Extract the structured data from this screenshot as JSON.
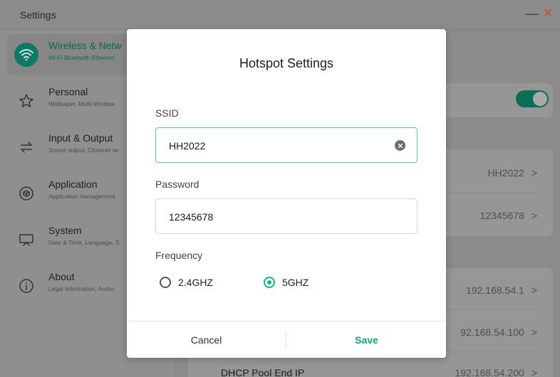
{
  "window": {
    "title": "Settings"
  },
  "sidebar": {
    "items": [
      {
        "title": "Wireless & Netw",
        "subtitle": "Wi-Fi Bluetooth Ethernet",
        "icon": "wifi-icon"
      },
      {
        "title": "Personal",
        "subtitle": "Wallpaper, Multi-Window",
        "icon": "star-icon"
      },
      {
        "title": "Input & Output",
        "subtitle": "Sound output, Channel se",
        "icon": "swap-arrows-icon"
      },
      {
        "title": "Application",
        "subtitle": "Application management",
        "icon": "cube-icon"
      },
      {
        "title": "System",
        "subtitle": "Date & Time, Language, S",
        "icon": "monitor-icon"
      },
      {
        "title": "About",
        "subtitle": "Legal information, Andro",
        "icon": "info-icon"
      }
    ]
  },
  "content": {
    "rows": [
      {
        "value": "HH2022",
        "chevron": ">"
      },
      {
        "value": "12345678",
        "chevron": ">"
      },
      {
        "value": "192.168.54.1",
        "chevron": ">"
      },
      {
        "value": "92.168.54.100",
        "chevron": ">"
      },
      {
        "label": "DHCP Pool End IP",
        "value": "192.168.54.200",
        "chevron": ">"
      }
    ]
  },
  "dialog": {
    "title": "Hotspot Settings",
    "ssid_label": "SSID",
    "ssid_value": "HH2022",
    "password_label": "Password",
    "password_value": "12345678",
    "frequency_label": "Frequency",
    "options": [
      "2.4GHZ",
      "5GHZ"
    ],
    "selected": "5GHZ",
    "cancel_label": "Cancel",
    "save_label": "Save"
  },
  "colors": {
    "accent": "#12b48a",
    "accent_dark": "#0c6e57"
  }
}
